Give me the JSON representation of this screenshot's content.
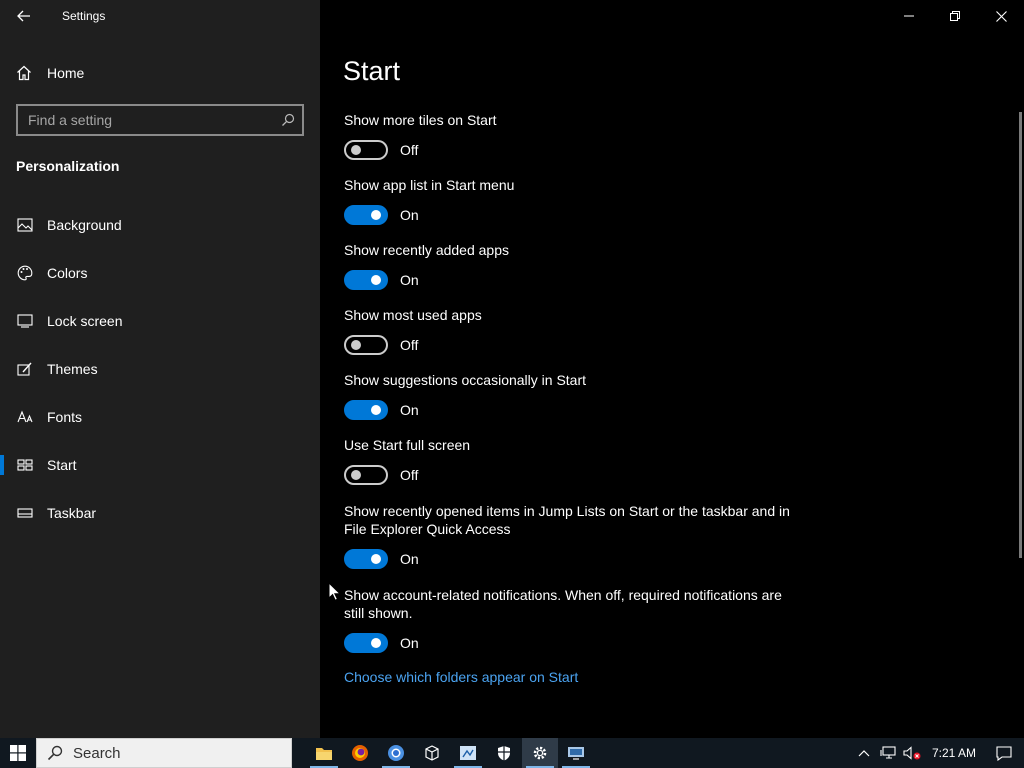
{
  "window": {
    "title": "Settings"
  },
  "sidebar": {
    "home_label": "Home",
    "search_placeholder": "Find a setting",
    "section_title": "Personalization",
    "items": [
      {
        "label": "Background",
        "icon": "image-icon"
      },
      {
        "label": "Colors",
        "icon": "palette-icon"
      },
      {
        "label": "Lock screen",
        "icon": "lock-screen-icon"
      },
      {
        "label": "Themes",
        "icon": "brush-icon"
      },
      {
        "label": "Fonts",
        "icon": "font-icon"
      },
      {
        "label": "Start",
        "icon": "start-tiles-icon",
        "active": true
      },
      {
        "label": "Taskbar",
        "icon": "taskbar-icon"
      }
    ]
  },
  "main": {
    "title": "Start",
    "settings": [
      {
        "label": "Show more tiles on Start",
        "state": "Off"
      },
      {
        "label": "Show app list in Start menu",
        "state": "On"
      },
      {
        "label": "Show recently added apps",
        "state": "On"
      },
      {
        "label": "Show most used apps",
        "state": "Off"
      },
      {
        "label": "Show suggestions occasionally in Start",
        "state": "On"
      },
      {
        "label": "Use Start full screen",
        "state": "Off"
      },
      {
        "label": "Show recently opened items in Jump Lists on Start or the taskbar and in File Explorer Quick Access",
        "state": "On"
      },
      {
        "label": "Show account-related notifications. When off, required notifications are still shown.",
        "state": "On"
      }
    ],
    "link": "Choose which folders appear on Start"
  },
  "taskbar": {
    "search_label": "Search",
    "clock": "7:21 AM",
    "apps": [
      "file-explorer-icon",
      "firefox-icon",
      "chrome-icon",
      "package-icon",
      "network-tool-icon",
      "security-shield-icon",
      "settings-gear-icon",
      "remote-desktop-icon"
    ]
  },
  "colors": {
    "accent": "#0078d7",
    "link": "#4ba3f0",
    "sidebar_bg": "#1f1f1f"
  }
}
